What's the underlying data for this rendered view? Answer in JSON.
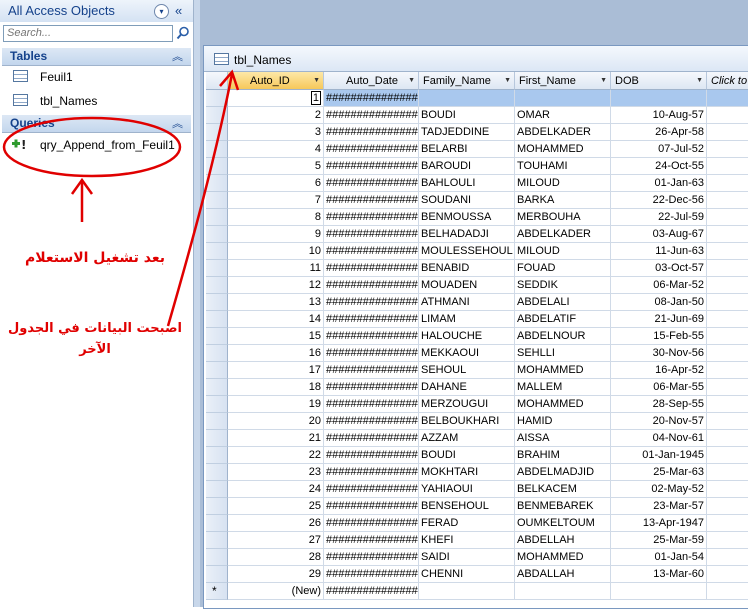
{
  "nav": {
    "title": "All Access Objects",
    "menu_glyph": "▾",
    "collapse_glyph": "«",
    "search_placeholder": "Search...",
    "groups": {
      "tables": {
        "label": "Tables",
        "chevron": "︽",
        "items": [
          "Feuil1",
          "tbl_Names"
        ]
      },
      "queries": {
        "label": "Queries",
        "chevron": "︽",
        "items": [
          "qry_Append_from_Feuil1"
        ]
      }
    }
  },
  "annotations": {
    "line1": "بعد تشغيل الاستعلام",
    "line2": "اصبحت البيانات في الجدول الآخر",
    "color": "#e00000"
  },
  "document": {
    "title": "tbl_Names"
  },
  "grid": {
    "columns": [
      "Auto_ID",
      "Auto_Date",
      "Family_Name",
      "First_Name",
      "DOB",
      "Click to Add"
    ],
    "hash": "################",
    "new_label": "(New)",
    "new_marker": "*",
    "rows": [
      [
        "1",
        "",
        "",
        ""
      ],
      [
        "2",
        "BOUDI",
        "OMAR",
        "10-Aug-57"
      ],
      [
        "3",
        "TADJEDDINE",
        "ABDELKADER",
        "26-Apr-58"
      ],
      [
        "4",
        "BELARBI",
        "MOHAMMED",
        "07-Jul-52"
      ],
      [
        "5",
        "BAROUDI",
        "TOUHAMI",
        "24-Oct-55"
      ],
      [
        "6",
        "BAHLOULI",
        "MILOUD",
        "01-Jan-63"
      ],
      [
        "7",
        "SOUDANI",
        "BARKA",
        "22-Dec-56"
      ],
      [
        "8",
        "BENMOUSSA",
        "MERBOUHA",
        "22-Jul-59"
      ],
      [
        "9",
        "BELHADADJI",
        "ABDELKADER",
        "03-Aug-67"
      ],
      [
        "10",
        "MOULESSEHOUL",
        "MILOUD",
        "11-Jun-63"
      ],
      [
        "11",
        "BENABID",
        "FOUAD",
        "03-Oct-57"
      ],
      [
        "12",
        "MOUADEN",
        "SEDDIK",
        "06-Mar-52"
      ],
      [
        "13",
        "ATHMANI",
        "ABDELALI",
        "08-Jan-50"
      ],
      [
        "14",
        "LIMAM",
        "ABDELATIF",
        "21-Jun-69"
      ],
      [
        "15",
        "HALOUCHE",
        "ABDELNOUR",
        "15-Feb-55"
      ],
      [
        "16",
        "MEKKAOUI",
        "SEHLLI",
        "30-Nov-56"
      ],
      [
        "17",
        "SEHOUL",
        "MOHAMMED",
        "16-Apr-52"
      ],
      [
        "18",
        "DAHANE",
        "MALLEM",
        "06-Mar-55"
      ],
      [
        "19",
        "MERZOUGUI",
        "MOHAMMED",
        "28-Sep-55"
      ],
      [
        "20",
        "BELBOUKHARI",
        "HAMID",
        "20-Nov-57"
      ],
      [
        "21",
        "AZZAM",
        "AISSA",
        "04-Nov-61"
      ],
      [
        "22",
        "BOUDI",
        "BRAHIM",
        "01-Jan-1945"
      ],
      [
        "23",
        "MOKHTARI",
        "ABDELMADJID",
        "25-Mar-63"
      ],
      [
        "24",
        "YAHIAOUI",
        "BELKACEM",
        "02-May-52"
      ],
      [
        "25",
        "BENSEHOUL",
        "BENMEBAREK",
        "23-Mar-57"
      ],
      [
        "26",
        "FERAD",
        "OUMKELTOUM",
        "13-Apr-1947"
      ],
      [
        "27",
        "KHEFI",
        "ABDELLAH",
        "25-Mar-59"
      ],
      [
        "28",
        "SAIDI",
        "MOHAMMED",
        "01-Jan-54"
      ],
      [
        "29",
        "CHENNI",
        "ABDALLAH",
        "13-Mar-60"
      ]
    ]
  }
}
